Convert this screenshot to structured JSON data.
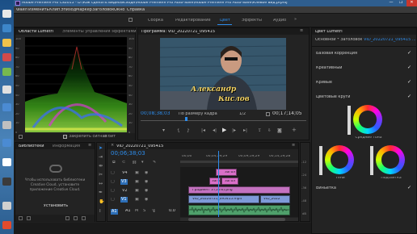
{
  "window": {
    "title": "Adobe Premiere Pro CS2015 - D:\\Как сделать видео\\исходн\\Adobe Premiere Pro Auto-Save\\Adobe Premiere Pro Auto-Save\\Клевое вид.prproj *",
    "controls": [
      "—",
      "❐",
      "✕"
    ]
  },
  "menu": [
    "Файл",
    "Изменить",
    "Клип",
    "Эпизод",
    "Маркер",
    "Заголовок",
    "Окно",
    "Справка"
  ],
  "workspaces": [
    "Сборка",
    "Редактирование",
    "Цвет",
    "Эффекты",
    "Аудио"
  ],
  "active_workspace": "Цвет",
  "scopes": {
    "tab_active": "Области Lumetri",
    "tab_other": "Элементы управления эффектами",
    "left_labels": [
      "100",
      "90",
      "80",
      "70",
      "60",
      "50",
      "40",
      "30",
      "20",
      "10",
      "0"
    ],
    "right_labels": [
      "100",
      "90",
      "80",
      "70",
      "60",
      "50",
      "40",
      "30",
      "20",
      "10",
      "0"
    ],
    "bottom_checkbox_label": "Закрепить сигнал",
    "bottom_bit": "8 бит"
  },
  "program": {
    "tab": "Программа: VID_20220721_095415",
    "title_overlay_line1": "Александр",
    "title_overlay_line2": "Кислов",
    "timecode": "00;08;38;03",
    "fit": "По размеру кадра",
    "ratio": "1/2",
    "duration": "00;17;14;05"
  },
  "lumetri": {
    "tab": "Цвет Lumetri",
    "preset_label": "Основной * Заголовок...",
    "clip_label": "VID_20220721_095415 ...",
    "sections": [
      "Базовая коррекция",
      "Креативный",
      "Кривые",
      "Цветовые круги",
      "Виньетка"
    ],
    "wheel_labels": {
      "mid": "Средние тона",
      "shadows": "Тени",
      "highlights": "Подсветка"
    }
  },
  "library": {
    "tab_active": "Библиотеки",
    "tab_other": "Информация",
    "message": "Чтобы использовать библиотеки Creative Cloud, установите приложение Creative Cloud.",
    "button": "Установить"
  },
  "timeline": {
    "tab": "VID_20220721_095415",
    "timecode": "00;06;38;03",
    "ruler": [
      "00;00",
      "00;04;59;29",
      "00;09;59;29",
      "00;14;59;28"
    ],
    "tracks": [
      {
        "name": "V4",
        "type": "video"
      },
      {
        "name": "V3",
        "type": "video"
      },
      {
        "name": "V2",
        "type": "video"
      },
      {
        "name": "V1",
        "type": "video"
      },
      {
        "name": "A1",
        "type": "audio"
      }
    ],
    "clips": [
      {
        "track": 0,
        "label": "Загол",
        "color": "#d96fc8"
      },
      {
        "track": 1,
        "label": "Загол",
        "color": "#d96fc8"
      },
      {
        "track": 1,
        "label": "Загол",
        "color": "#d96fc8"
      },
      {
        "track": 2,
        "label": "Градиент 3 (50%).png",
        "color": "#c472c0"
      },
      {
        "track": 3,
        "label": "VID_20220721_095415.mp4",
        "color": "#7e9ad9"
      },
      {
        "track": 3,
        "label": "VID_2022",
        "color": "#7e9ad9"
      },
      {
        "track": 4,
        "label": "",
        "color": "#4fa06b"
      }
    ],
    "audio_level": "0.0",
    "meter_labels": [
      "-12",
      "-24",
      "-36",
      "-48",
      "dB"
    ]
  },
  "colors": {
    "accent": "#2d8ceb",
    "title_bar": "#2f5e8e",
    "video_clip": "#7e9ad9",
    "title_clip": "#d96fc8"
  }
}
